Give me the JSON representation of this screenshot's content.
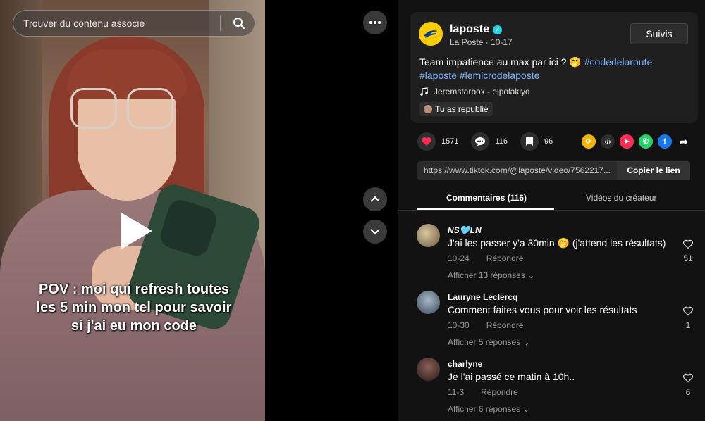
{
  "search": {
    "placeholder": "Trouver du contenu associé"
  },
  "video": {
    "caption": "POV : moi qui refresh toutes\nles 5 min mon tel pour savoir\nsi j'ai eu mon code"
  },
  "post": {
    "username": "laposte",
    "subtitle": "La Poste · 10-17",
    "follow_label": "Suivis",
    "desc_text": "Team impatience au max par ici ? 🤭 ",
    "hashtags_line1": "#codedelaroute",
    "hashtags_line2": "#laposte #lemicrodelaposte",
    "music": "Jeremstarbox - elpolaklyd",
    "repost_label": "Tu as republié"
  },
  "stats": {
    "likes": "1571",
    "comments": "116",
    "saves": "96"
  },
  "share": {
    "url": "https://www.tiktok.com/@laposte/video/7562217...",
    "copy_label": "Copier le lien"
  },
  "tabs": {
    "comments": "Commentaires (116)",
    "creator_videos": "Vidéos du créateur"
  },
  "comments": [
    {
      "name": "NS🩵LN",
      "text": "J'ai les passer y'a 30min 🤭 (j'attend les résultats)",
      "date": "10-24",
      "reply": "Répondre",
      "more": "Afficher 13 réponses",
      "likes": "51"
    },
    {
      "name": "Lauryne Leclercq",
      "text": "Comment faites vous pour voir les résultats",
      "date": "10-30",
      "reply": "Répondre",
      "more": "Afficher 5 réponses",
      "likes": "1"
    },
    {
      "name": "charlyne",
      "text": "Je l'ai passé ce matin à 10h..",
      "date": "11-3",
      "reply": "Répondre",
      "more": "Afficher 6 réponses",
      "likes": "6"
    }
  ],
  "colors": {
    "accent_hashtag": "#7db2ff",
    "like_red": "#fe2c55",
    "logo_yellow": "#ffcc00"
  }
}
